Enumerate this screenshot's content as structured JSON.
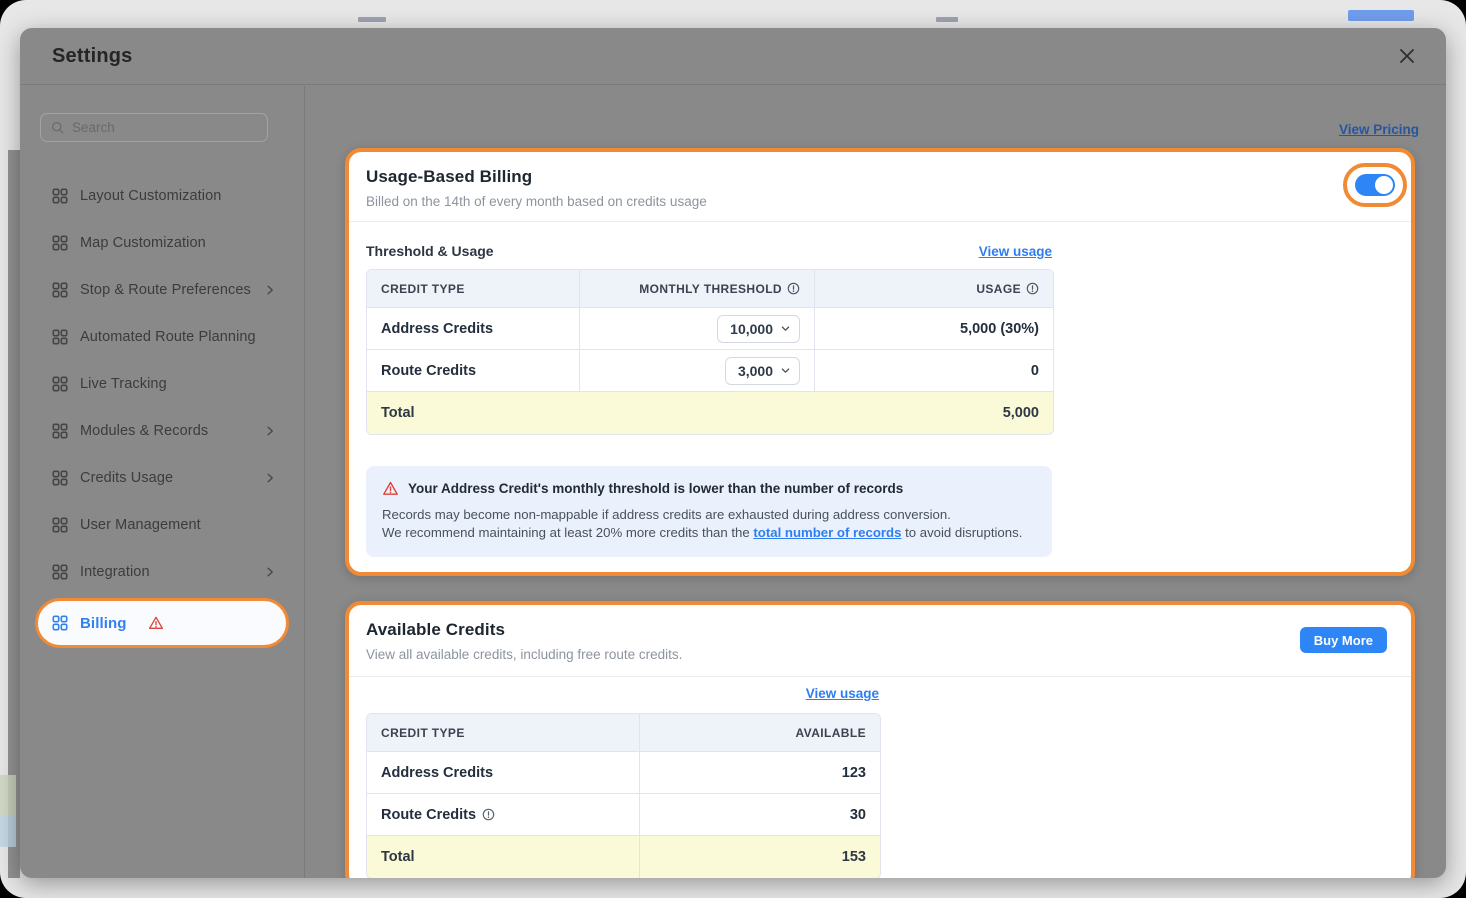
{
  "modal": {
    "title": "Settings"
  },
  "sidebar": {
    "search_placeholder": "Search",
    "items": [
      {
        "label": "Layout Customization"
      },
      {
        "label": "Map Customization"
      },
      {
        "label": "Stop & Route Preferences"
      },
      {
        "label": "Automated Route Planning"
      },
      {
        "label": "Live Tracking"
      },
      {
        "label": "Modules & Records"
      },
      {
        "label": "Credits Usage"
      },
      {
        "label": "User Management"
      },
      {
        "label": "Integration"
      },
      {
        "label": "Billing"
      }
    ]
  },
  "content": {
    "view_pricing": "View Pricing"
  },
  "usage_billing": {
    "title": "Usage-Based Billing",
    "subtitle": "Billed on the 14th of every month based on credits usage",
    "toggle_state": "on",
    "section_title": "Threshold & Usage",
    "view_usage": "View usage",
    "table": {
      "headers": [
        "CREDIT TYPE",
        "MONTHLY THRESHOLD",
        "USAGE"
      ],
      "rows": [
        {
          "type": "Address Credits",
          "threshold": "10,000",
          "usage": "5,000 (30%)"
        },
        {
          "type": "Route Credits",
          "threshold": "3,000",
          "usage": "0"
        }
      ],
      "total_label": "Total",
      "total_value": "5,000"
    },
    "warning": {
      "title": "Your Address Credit's monthly threshold is lower than the number of records",
      "line1": "Records may become non-mappable if address credits are exhausted during address conversion.",
      "line2_prefix": "We recommend maintaining at least 20% more credits than the ",
      "line2_link": "total number of records",
      "line2_suffix": " to avoid disruptions."
    }
  },
  "available_credits": {
    "title": "Available Credits",
    "subtitle": "View all available credits, including free route credits.",
    "buy_more": "Buy More",
    "view_usage": "View usage",
    "table": {
      "headers": [
        "CREDIT TYPE",
        "AVAILABLE"
      ],
      "rows": [
        {
          "type": "Address Credits",
          "available": "123"
        },
        {
          "type": "Route Credits",
          "available": "30"
        }
      ],
      "total_label": "Total",
      "total_value": "153"
    }
  },
  "colors": {
    "highlight_orange": "#f18a34",
    "link_blue": "#2e7ef0",
    "primary_blue": "#2e86f6",
    "warning_red": "#d9453d",
    "total_yellow": "#fafad9",
    "dim_overlay_gray": "#898989"
  }
}
